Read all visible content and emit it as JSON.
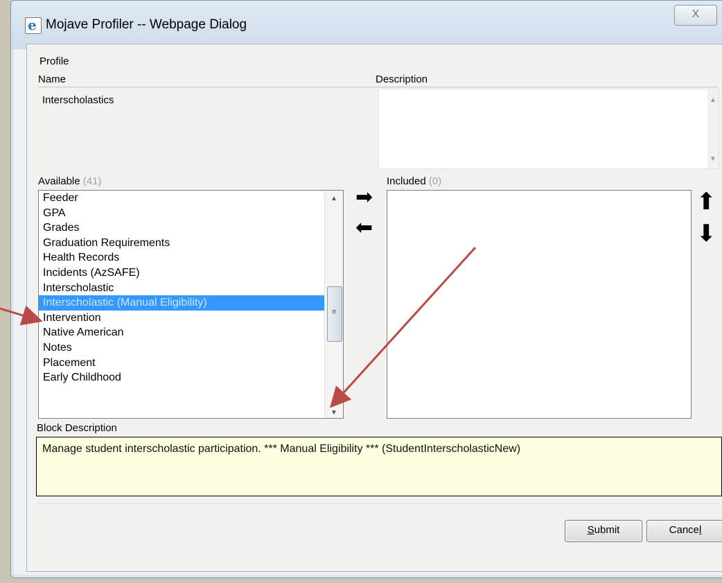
{
  "window": {
    "title": "Mojave Profiler -- Webpage Dialog",
    "close_label": "X"
  },
  "profile": {
    "section_label": "Profile",
    "name_label": "Name",
    "description_label": "Description",
    "name_value": "Interscholastics",
    "description_value": ""
  },
  "available": {
    "label": "Available",
    "count": "(41)",
    "items": [
      {
        "label": "Feeder",
        "selected": false
      },
      {
        "label": "GPA",
        "selected": false
      },
      {
        "label": "Grades",
        "selected": false
      },
      {
        "label": "Graduation Requirements",
        "selected": false
      },
      {
        "label": "Health Records",
        "selected": false
      },
      {
        "label": "Incidents (AzSAFE)",
        "selected": false
      },
      {
        "label": "Interscholastic",
        "selected": false
      },
      {
        "label": "Interscholastic (Manual Eligibility)",
        "selected": true
      },
      {
        "label": "Intervention",
        "selected": false
      },
      {
        "label": "Native American",
        "selected": false
      },
      {
        "label": "Notes",
        "selected": false
      },
      {
        "label": "Placement",
        "selected": false
      },
      {
        "label": "Early Childhood",
        "selected": false
      }
    ]
  },
  "included": {
    "label": "Included",
    "count": "(0)",
    "items": []
  },
  "block": {
    "label": "Block Description",
    "text": "Manage student interscholastic participation. *** Manual Eligibility *** (StudentInterscholasticNew)"
  },
  "buttons": {
    "submit_prefix": "",
    "submit_accel": "S",
    "submit_rest": "ubmit",
    "cancel_prefix": "Cance",
    "cancel_accel": "l",
    "cancel_rest": ""
  },
  "icons": {
    "add": "arrow-right-icon",
    "remove": "arrow-left-icon",
    "move_up": "arrow-up-icon",
    "move_down": "arrow-down-icon"
  },
  "colors": {
    "selection": "#3399ff",
    "annotation_arrow": "#b94a48",
    "block_bg": "#fdfde0"
  }
}
